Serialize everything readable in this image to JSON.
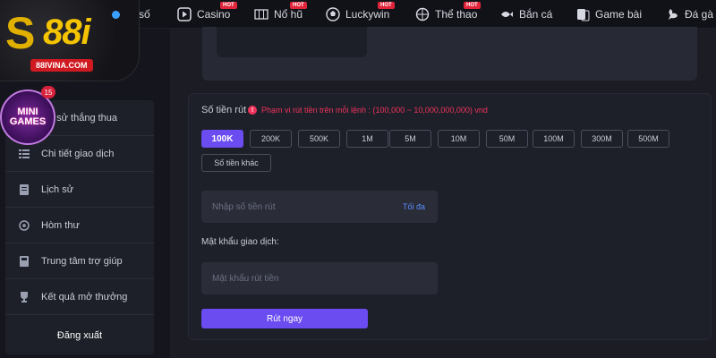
{
  "nav": {
    "items": [
      {
        "label": "ổ số",
        "icon": "lottery-icon",
        "hot": false
      },
      {
        "label": "Casino",
        "icon": "play-icon",
        "hot": true
      },
      {
        "label": "Nổ hũ",
        "icon": "slot-machine-icon",
        "hot": true
      },
      {
        "label": "Luckywin",
        "icon": "ball-icon",
        "hot": true
      },
      {
        "label": "Thể thao",
        "icon": "sports-icon",
        "hot": true
      },
      {
        "label": "Bắn cá",
        "icon": "fish-icon",
        "hot": false
      },
      {
        "label": "Game bài",
        "icon": "cards-icon",
        "hot": false
      },
      {
        "label": "Đá gà",
        "icon": "rooster-icon",
        "hot": false
      }
    ],
    "hot_label": "HOT"
  },
  "logo": {
    "text": "88i",
    "subtext": "88IVINA.COM"
  },
  "mini_games": {
    "label_line1": "MINI",
    "label_line2": "GAMES",
    "badge": "15"
  },
  "sidebar": {
    "items": [
      {
        "label": "ịch sử thắng thua",
        "icon": "history-icon"
      },
      {
        "label": "Chi tiết giao dịch",
        "icon": "list-icon"
      },
      {
        "label": "Lịch sử",
        "icon": "document-icon"
      },
      {
        "label": "Hòm thư",
        "icon": "mail-icon"
      },
      {
        "label": "Trung tâm trợ giúp",
        "icon": "help-book-icon"
      },
      {
        "label": "Kết quả mở thưởng",
        "icon": "trophy-icon"
      }
    ],
    "logout": "Đăng xuất"
  },
  "withdraw": {
    "amount_label": "Số tiền rút",
    "range_note": "Phạm vi rút tiền trên mỗi lệnh : (100,000 ~ 10,000,000,000) vnd",
    "chips": [
      "100K",
      "200K",
      "500K",
      "1M",
      "5M",
      "10M",
      "50M",
      "100M",
      "300M",
      "500M"
    ],
    "selected_chip": "100K",
    "other_amount": "Số tiền khác",
    "amount_placeholder": "Nhập số tiền rút",
    "max_label": "Tối đa",
    "password_label": "Mật khẩu giao dịch:",
    "password_placeholder": "Mật khẩu rút tiền",
    "submit_label": "Rút ngay"
  },
  "colors": {
    "accent": "#6a4cf0",
    "hot": "#e0243a",
    "warning": "#f0325c",
    "link": "#5b8cff"
  }
}
